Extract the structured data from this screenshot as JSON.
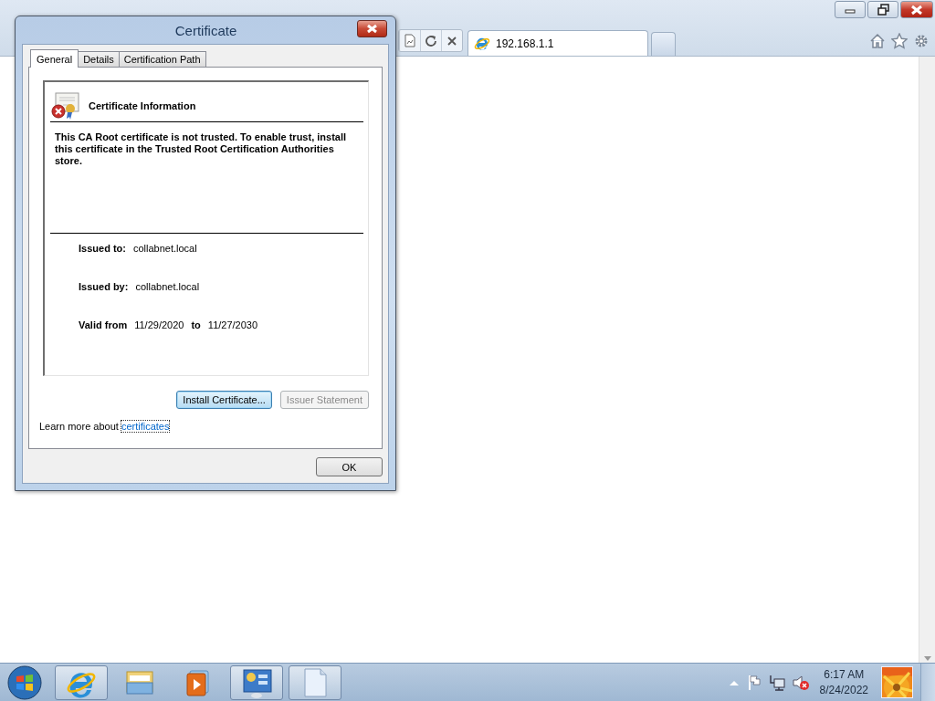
{
  "browser": {
    "tabs": [
      {
        "label": "192.168.1.1",
        "selected": true
      }
    ]
  },
  "dialog": {
    "title": "Certificate",
    "tabs": [
      {
        "label": "General",
        "selected": true
      },
      {
        "label": "Details",
        "selected": false
      },
      {
        "label": "Certification Path",
        "selected": false
      }
    ],
    "heading": "Certificate Information",
    "message": "This CA Root certificate is not trusted. To enable trust, install this certificate in the Trusted Root Certification Authorities store.",
    "fields": [
      {
        "label": "Issued to:",
        "value": "collabnet.local"
      },
      {
        "label": "Issued by:",
        "value": "collabnet.local"
      }
    ],
    "validity": {
      "from_label": "Valid from",
      "from": "11/29/2020",
      "to_label": "to",
      "to": "11/27/2030"
    },
    "buttons": [
      {
        "label": "Install Certificate...",
        "disabled": false,
        "focused": true
      },
      {
        "label": "Issuer Statement",
        "disabled": true,
        "focused": false
      }
    ],
    "learn_more": {
      "text": "Learn more about",
      "link": "certificates"
    },
    "ok": "OK"
  },
  "taskbar": {
    "apps": [
      {
        "kind": "browser",
        "running": true
      },
      {
        "kind": "folder",
        "running": false
      },
      {
        "kind": "media",
        "running": false
      },
      {
        "kind": "control",
        "running": true
      },
      {
        "kind": "document",
        "running": true
      }
    ],
    "clock": {
      "time": "6:17 AM",
      "date": "8/24/2022"
    }
  }
}
